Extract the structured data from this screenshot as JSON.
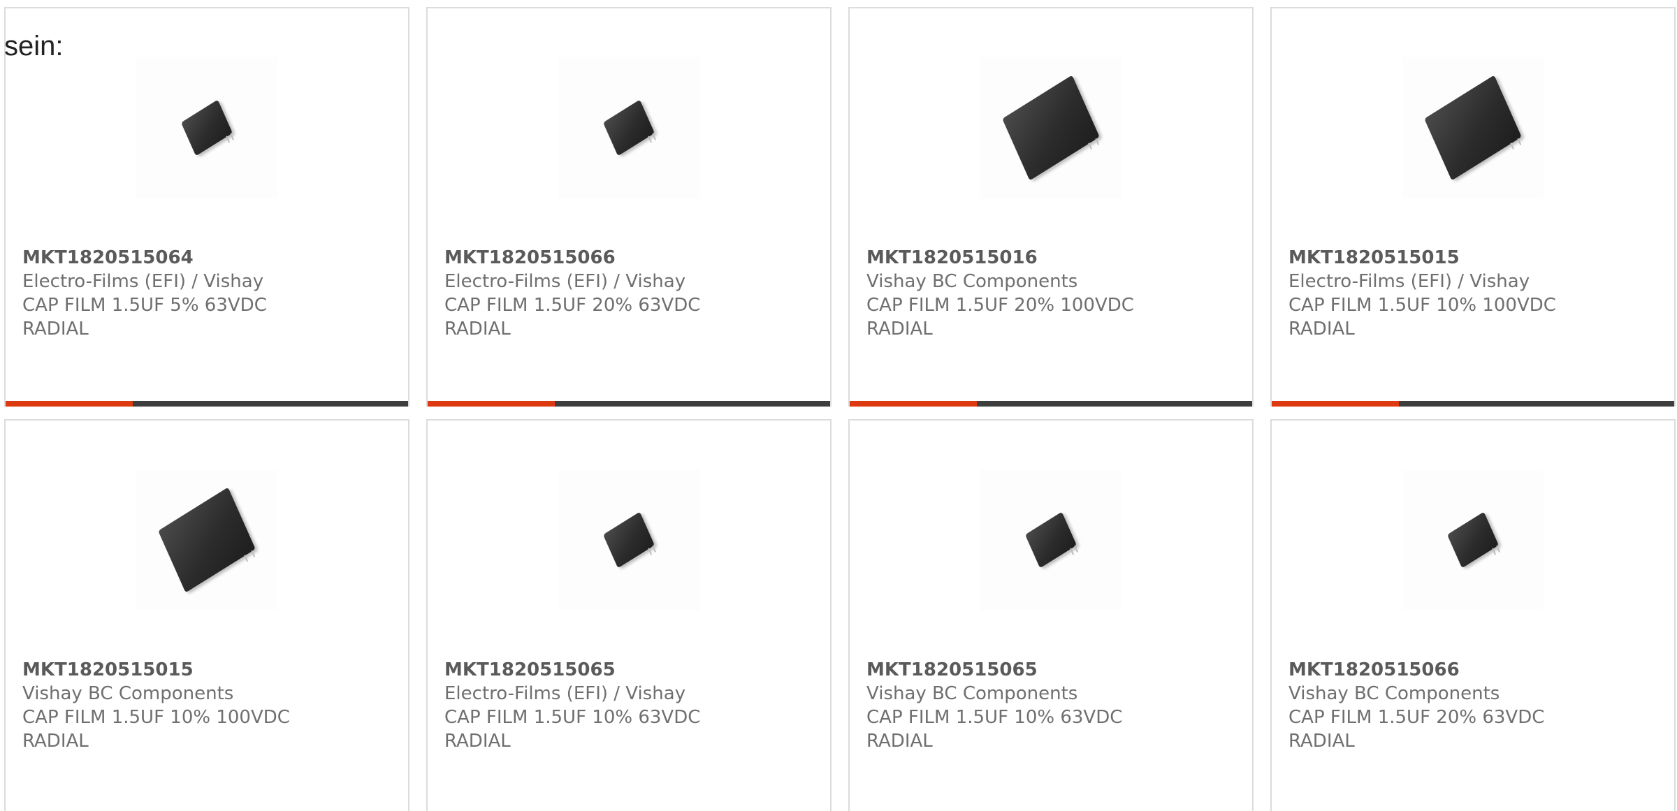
{
  "intro_text": "sein:",
  "colors": {
    "accent": "#dd3a12",
    "bar_dark": "#3e3e3e",
    "border": "#dcdcdc",
    "text": "#6f6f6f"
  },
  "products": [
    {
      "part_number": "MKT1820515064",
      "manufacturer": "Electro-Films (EFI) / Vishay",
      "description": "CAP FILM 1.5UF 5% 63VDC",
      "package": "RADIAL",
      "image_icon": "film-capacitor-small-icon"
    },
    {
      "part_number": "MKT1820515066",
      "manufacturer": "Electro-Films (EFI) / Vishay",
      "description": "CAP FILM 1.5UF 20% 63VDC",
      "package": "RADIAL",
      "image_icon": "film-capacitor-small-icon"
    },
    {
      "part_number": "MKT1820515016",
      "manufacturer": "Vishay BC Components",
      "description": "CAP FILM 1.5UF 20% 100VDC",
      "package": "RADIAL",
      "image_icon": "film-capacitor-large-icon"
    },
    {
      "part_number": "MKT1820515015",
      "manufacturer": "Electro-Films (EFI) / Vishay",
      "description": "CAP FILM 1.5UF 10% 100VDC",
      "package": "RADIAL",
      "image_icon": "film-capacitor-large-icon"
    },
    {
      "part_number": "MKT1820515015",
      "manufacturer": "Vishay BC Components",
      "description": "CAP FILM 1.5UF 10% 100VDC",
      "package": "RADIAL",
      "image_icon": "film-capacitor-large-icon"
    },
    {
      "part_number": "MKT1820515065",
      "manufacturer": "Electro-Films (EFI) / Vishay",
      "description": "CAP FILM 1.5UF 10% 63VDC",
      "package": "RADIAL",
      "image_icon": "film-capacitor-small-icon"
    },
    {
      "part_number": "MKT1820515065",
      "manufacturer": "Vishay BC Components",
      "description": "CAP FILM 1.5UF 10% 63VDC",
      "package": "RADIAL",
      "image_icon": "film-capacitor-small-icon"
    },
    {
      "part_number": "MKT1820515066",
      "manufacturer": "Vishay BC Components",
      "description": "CAP FILM 1.5UF 20% 63VDC",
      "package": "RADIAL",
      "image_icon": "film-capacitor-small-icon"
    }
  ]
}
